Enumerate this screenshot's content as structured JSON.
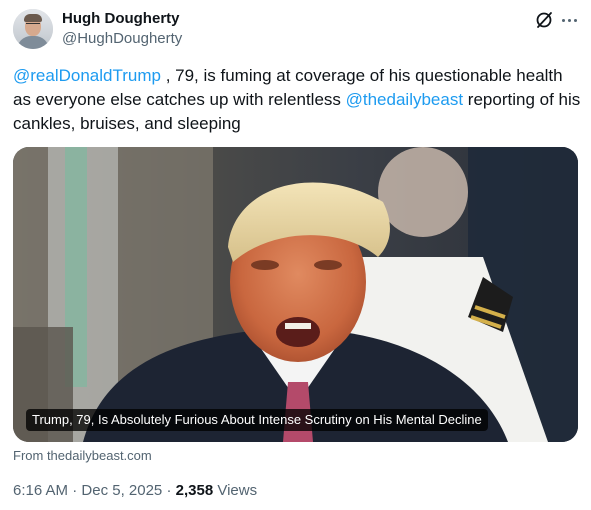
{
  "author": {
    "name": "Hugh Dougherty",
    "handle": "@HughDougherty"
  },
  "icons": {
    "grok": "grok-icon",
    "more": "more-icon",
    "avatar": "avatar-photo"
  },
  "tweet": {
    "mention1": "@realDonaldTrump",
    "text1": " , 79, is fuming at coverage of his questionable health as everyone else catches up with relentless ",
    "mention2": "@thedailybeast",
    "text2": " reporting of his cankles, bruises, and sleeping"
  },
  "media": {
    "caption": "Trump, 79, Is Absolutely Furious About Intense Scrutiny on His Mental Decline",
    "source": "From thedailybeast.com"
  },
  "meta": {
    "time": "6:16 AM",
    "separator": " · ",
    "date": "Dec 5, 2025",
    "views_count": "2,358",
    "views_label": " Views"
  },
  "colors": {
    "link": "#1d9bf0",
    "secondary_text": "#536471",
    "primary_text": "#0f1419"
  }
}
